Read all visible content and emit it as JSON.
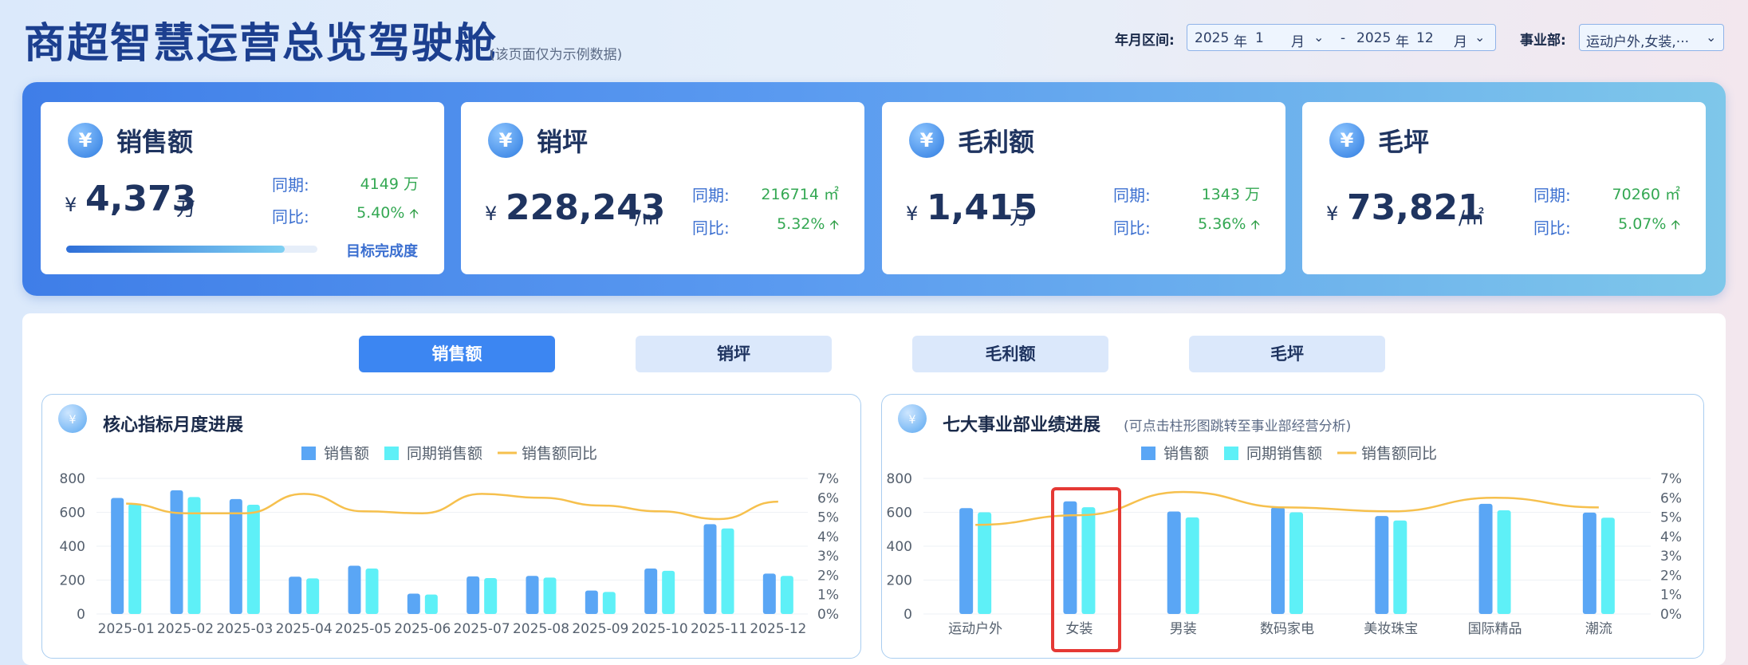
{
  "header": {
    "title": "商超智慧运营总览驾驶舱",
    "subtitle": "(该页面仅为示例数据)",
    "date_label": "年月区间:",
    "date_start_year": "2025",
    "date_start_month": "1",
    "date_sep": "-",
    "date_end_year": "2025",
    "date_end_month": "12",
    "year_char": "年",
    "month_char": "月",
    "dept_label": "事业部:",
    "dept_value": "运动户外,女装,···"
  },
  "kpis": [
    {
      "name": "销售额",
      "currency": "¥",
      "value": "4,373",
      "unit": "万",
      "yoy_label": "同期:",
      "yoy_value": "4149 万",
      "ratio_label": "同比:",
      "ratio_value": "5.40%",
      "target_label": "目标完成度",
      "target_progress": 0.87
    },
    {
      "name": "销坪",
      "currency": "¥",
      "value": "228,243",
      "unit": "/㎡",
      "yoy_label": "同期:",
      "yoy_value": "216714 ㎡",
      "ratio_label": "同比:",
      "ratio_value": "5.32%"
    },
    {
      "name": "毛利额",
      "currency": "¥",
      "value": "1,415",
      "unit": "万",
      "yoy_label": "同期:",
      "yoy_value": "1343 万",
      "ratio_label": "同比:",
      "ratio_value": "5.36%"
    },
    {
      "name": "毛坪",
      "currency": "¥",
      "value": "73,821",
      "unit": "/㎡",
      "yoy_label": "同期:",
      "yoy_value": "70260 ㎡",
      "ratio_label": "同比:",
      "ratio_value": "5.07%"
    }
  ],
  "tabs": [
    "销售额",
    "销坪",
    "毛利额",
    "毛坪"
  ],
  "active_tab": 0,
  "icons": {
    "currency": "yen-icon",
    "up": "arrow-up-icon",
    "dropdown": "chevron-down-icon"
  },
  "colors": {
    "bar_current": "#5aa6f5",
    "bar_prev": "#5ef0f7",
    "line": "#f6c04d",
    "accent": "#3c86f2",
    "up": "#2e9e45"
  },
  "chart_left": {
    "title": "核心指标月度进展"
  },
  "chart_right": {
    "title": "七大事业部业绩进展",
    "note": "(可点击柱形图跳转至事业部经营分析)"
  },
  "chart_data": [
    {
      "type": "bar",
      "categories": [
        "2025-01",
        "2025-02",
        "2025-03",
        "2025-04",
        "2025-05",
        "2025-06",
        "2025-07",
        "2025-08",
        "2025-09",
        "2025-10",
        "2025-11",
        "2025-12"
      ],
      "series": [
        {
          "name": "销售额",
          "values": [
            685,
            730,
            678,
            220,
            285,
            120,
            222,
            225,
            138,
            268,
            530,
            238
          ]
        },
        {
          "name": "同期销售额",
          "values": [
            650,
            690,
            645,
            210,
            268,
            115,
            212,
            215,
            130,
            255,
            505,
            225
          ]
        },
        {
          "name": "销售额同比",
          "axis": "right",
          "type": "line",
          "values": [
            5.7,
            5.2,
            5.2,
            6.2,
            5.3,
            5.2,
            6.2,
            6.0,
            5.6,
            5.3,
            4.9,
            5.8
          ]
        }
      ],
      "ylim": [
        0,
        800
      ],
      "yticks": [
        "800",
        "600",
        "400",
        "200",
        "0"
      ],
      "y2lim": [
        0,
        7
      ],
      "y2ticks": [
        "7%",
        "6%",
        "5%",
        "4%",
        "3%",
        "2%",
        "1%",
        "0%"
      ],
      "legend": "top-center"
    },
    {
      "type": "bar",
      "categories": [
        "运动户外",
        "女装",
        "男装",
        "数码家电",
        "美妆珠宝",
        "国际精品",
        "潮流"
      ],
      "series": [
        {
          "name": "销售额",
          "values": [
            625,
            665,
            605,
            630,
            578,
            650,
            598
          ]
        },
        {
          "name": "同期销售额",
          "values": [
            600,
            630,
            570,
            600,
            552,
            612,
            568
          ]
        },
        {
          "name": "销售额同比",
          "axis": "right",
          "type": "line",
          "values": [
            4.6,
            5.1,
            6.3,
            5.5,
            5.3,
            6.0,
            5.5
          ]
        }
      ],
      "ylim": [
        0,
        800
      ],
      "yticks": [
        "800",
        "600",
        "400",
        "200",
        "0"
      ],
      "y2lim": [
        0,
        7
      ],
      "y2ticks": [
        "7%",
        "6%",
        "5%",
        "4%",
        "3%",
        "2%",
        "1%",
        "0%"
      ],
      "legend": "top-center"
    }
  ]
}
